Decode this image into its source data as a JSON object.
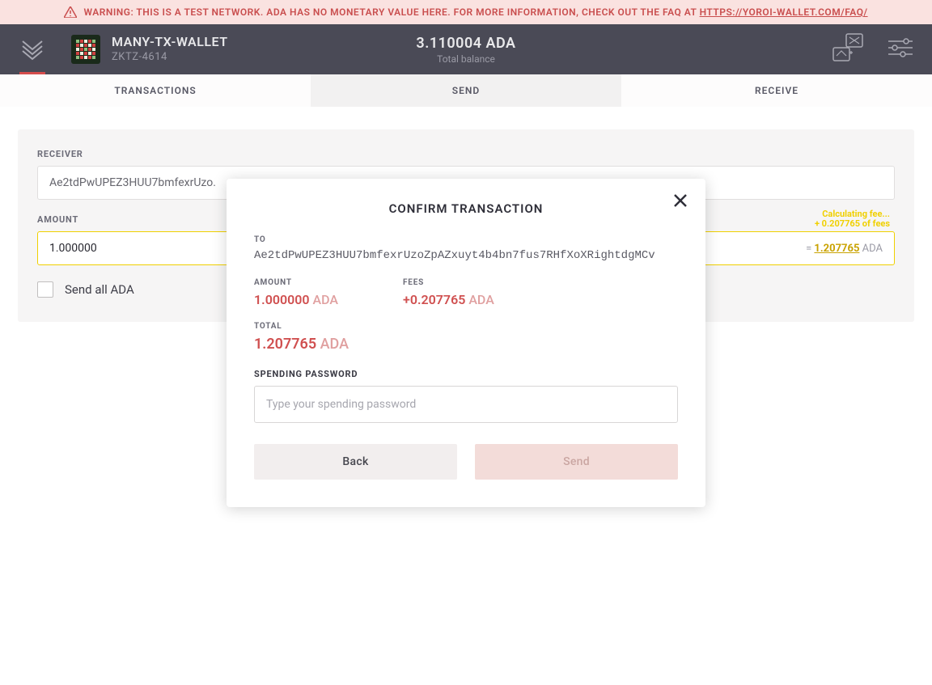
{
  "warning": {
    "text": "WARNING: THIS IS A TEST NETWORK. ADA HAS NO MONETARY VALUE HERE. FOR MORE INFORMATION, CHECK OUT THE FAQ AT ",
    "link_text": "HTTPS://YOROI-WALLET.COM/FAQ/"
  },
  "header": {
    "wallet_name": "MANY-TX-WALLET",
    "wallet_id": "ZKTZ-4614",
    "balance_amount": "3.110004 ADA",
    "balance_label": "Total balance"
  },
  "tabs": {
    "transactions": "TRANSACTIONS",
    "send": "SEND",
    "receive": "RECEIVE"
  },
  "form": {
    "receiver_label": "RECEIVER",
    "receiver_value": "Ae2tdPwUPEZ3HUU7bmfexrUzo.",
    "amount_label": "AMOUNT",
    "amount_value": "1.000000",
    "fee_calc_text": "Calculating fee...",
    "fee_text": "+ 0.207765 of fees",
    "total_prefix": "= ",
    "total_value": "1.207765",
    "total_suffix": " ADA",
    "send_all_label": "Send all ADA"
  },
  "modal": {
    "title": "CONFIRM TRANSACTION",
    "to_label": "TO",
    "to_value": "Ae2tdPwUPEZ3HUU7bmfexrUzoZpAZxuyt4b4bn7fus7RHfXoXRightdgMCv",
    "amount_label": "AMOUNT",
    "amount_value": "1.000000",
    "amount_currency": " ADA",
    "fees_label": "FEES",
    "fees_value": "+0.207765",
    "fees_currency": " ADA",
    "total_label": "TOTAL",
    "total_value": "1.207765",
    "total_currency": " ADA",
    "password_label": "SPENDING PASSWORD",
    "password_placeholder": "Type your spending password",
    "back_button": "Back",
    "send_button": "Send"
  }
}
